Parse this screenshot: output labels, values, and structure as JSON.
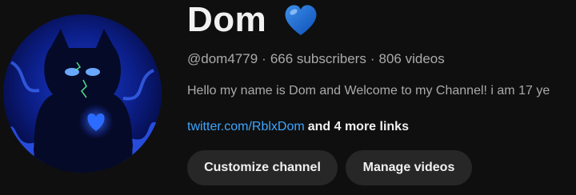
{
  "channel": {
    "name": "Dom",
    "handle": "@dom4779",
    "subscribers": "666 subscribers",
    "videos": "806 videos",
    "separator": "·",
    "description": "Hello my name is Dom and Welcome to my Channel! i am 17 ye",
    "link_text": "twitter.com/RblxDom",
    "more_links": "and 4 more links"
  },
  "buttons": {
    "customize": "Customize channel",
    "manage": "Manage videos"
  },
  "icons": {
    "name_badge": "blue-heart-icon",
    "avatar": "channel-avatar"
  },
  "colors": {
    "background": "#0f0f0f",
    "link": "#3ea6ff",
    "button_bg": "#272727",
    "heart": "#1e6fd9"
  }
}
